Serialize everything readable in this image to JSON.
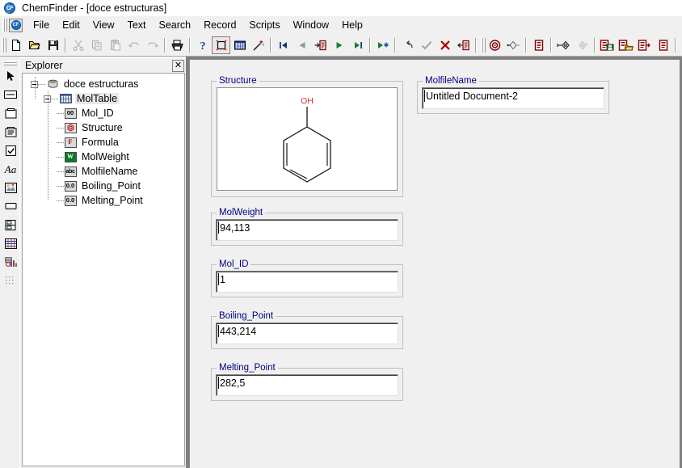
{
  "window": {
    "app_icon": "chemfinder-logo-icon",
    "title": "ChemFinder - [doce estructuras]"
  },
  "menubar": {
    "app_icon": "chemfinder-menu-icon",
    "items": [
      {
        "label": "File"
      },
      {
        "label": "Edit"
      },
      {
        "label": "View"
      },
      {
        "label": "Text"
      },
      {
        "label": "Search"
      },
      {
        "label": "Record"
      },
      {
        "label": "Scripts"
      },
      {
        "label": "Window"
      },
      {
        "label": "Help"
      }
    ]
  },
  "toolbar": {
    "buttons": [
      {
        "name": "new-document-icon"
      },
      {
        "name": "open-folder-icon"
      },
      {
        "name": "save-disk-icon"
      },
      {
        "name": "cut-scissors-icon"
      },
      {
        "name": "copy-icon"
      },
      {
        "name": "paste-clipboard-icon"
      },
      {
        "name": "undo-icon"
      },
      {
        "name": "redo-icon"
      },
      {
        "name": "print-icon"
      },
      {
        "name": "help-question-icon"
      },
      {
        "name": "form-view-icon"
      },
      {
        "name": "table-view-icon"
      },
      {
        "name": "edit-mode-wand-icon"
      },
      {
        "name": "first-record-icon"
      },
      {
        "name": "previous-record-icon"
      },
      {
        "name": "previous-page-icon"
      },
      {
        "name": "next-record-icon"
      },
      {
        "name": "last-record-icon"
      },
      {
        "name": "find-next-icon"
      },
      {
        "name": "undo-search-icon"
      },
      {
        "name": "commit-check-icon"
      },
      {
        "name": "delete-cross-icon"
      },
      {
        "name": "new-record-icon"
      },
      {
        "name": "search-target-icon"
      },
      {
        "name": "subsearch-icon"
      },
      {
        "name": "list-records-icon"
      },
      {
        "name": "key-icon"
      },
      {
        "name": "key-disabled-icon"
      },
      {
        "name": "save-database-icon"
      },
      {
        "name": "open-database-icon"
      },
      {
        "name": "export-database-icon"
      },
      {
        "name": "records-list-icon"
      }
    ]
  },
  "left_palette": {
    "tools": [
      {
        "name": "pointer-arrow-tool"
      },
      {
        "name": "text-box-tool"
      },
      {
        "name": "structure-box-tool"
      },
      {
        "name": "list-box-tool"
      },
      {
        "name": "check-box-tool"
      },
      {
        "name": "text-label-tool"
      },
      {
        "name": "picture-box-tool"
      },
      {
        "name": "button-tool"
      },
      {
        "name": "subform-tool"
      },
      {
        "name": "table-tool"
      },
      {
        "name": "chart-tool"
      },
      {
        "name": "grid-tool"
      }
    ]
  },
  "explorer": {
    "title": "Explorer",
    "close_label": "✕",
    "tree": {
      "database": {
        "label": "doce estructuras",
        "icon": "database-cylinder-icon",
        "expanded": true
      },
      "table": {
        "label": "MolTable",
        "icon": "table-grid-icon",
        "expanded": true,
        "selected": true
      },
      "fields": [
        {
          "label": "Mol_ID",
          "icon": "integer-field-icon",
          "glyph": "00"
        },
        {
          "label": "Structure",
          "icon": "structure-field-icon",
          "glyph": ""
        },
        {
          "label": "Formula",
          "icon": "formula-field-icon",
          "glyph": "F"
        },
        {
          "label": "MolWeight",
          "icon": "molweight-field-icon",
          "glyph": "W"
        },
        {
          "label": "MolfileName",
          "icon": "text-field-icon",
          "glyph": "abc"
        },
        {
          "label": "Boiling_Point",
          "icon": "number-field-icon",
          "glyph": "0.0"
        },
        {
          "label": "Melting_Point",
          "icon": "number-field-icon",
          "glyph": "0.0"
        }
      ]
    }
  },
  "form": {
    "structure_box": {
      "legend": "Structure",
      "molecule": "phenol",
      "atom_label": "OH",
      "atom_label_color": "#e03030"
    },
    "fields": [
      {
        "legend": "MolfileName",
        "value": "Untitled Document-2"
      },
      {
        "legend": "MolWeight",
        "value": "94,113"
      },
      {
        "legend": "Mol_ID",
        "value": "1"
      },
      {
        "legend": "Boiling_Point",
        "value": "443,214"
      },
      {
        "legend": "Melting_Point",
        "value": "282,5"
      }
    ]
  },
  "colors": {
    "legend_text": "#000080",
    "window_bg": "#f0f0f0",
    "field_bg": "#ffffff",
    "mdi_bg": "#808080",
    "toolbar_icon_dark_red": "#800000",
    "toolbar_icon_green": "#008000"
  }
}
